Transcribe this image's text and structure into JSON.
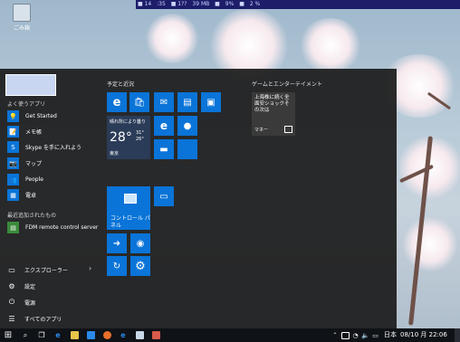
{
  "desktop": {
    "icon_label": "ごみ箱",
    "topbar_items": [
      "■ 14",
      ":35",
      "■ 1??",
      "39 MB",
      "■",
      "9%",
      "■",
      "2 %"
    ]
  },
  "start_menu": {
    "frequent_header": "よく使うアプリ",
    "recent_header": "最近追加されたもの",
    "frequent_apps": [
      {
        "label": "Get Started",
        "icon": "lightbulb-icon",
        "glyph": "💡",
        "color": "#0a74d8"
      },
      {
        "label": "メモ帳",
        "icon": "notepad-icon",
        "glyph": "📝",
        "color": "#0a74d8"
      },
      {
        "label": "Skype を手に入れよう",
        "icon": "skype-icon",
        "glyph": "S",
        "color": "#0a74d8"
      },
      {
        "label": "マップ",
        "icon": "maps-icon",
        "glyph": "📷",
        "color": "#0a74d8"
      },
      {
        "label": "People",
        "icon": "people-icon",
        "glyph": "👥",
        "color": "#0a74d8"
      },
      {
        "label": "電卓",
        "icon": "calculator-icon",
        "glyph": "▦",
        "color": "#0a74d8"
      }
    ],
    "recent_apps": [
      {
        "label": "FDM remote control server",
        "icon": "fdm-icon",
        "glyph": "▤",
        "color": "#3a8a3a"
      }
    ],
    "system_items": [
      {
        "label": "エクスプローラー",
        "icon": "folder-icon",
        "glyph": "▭",
        "has_chevron": true
      },
      {
        "label": "設定",
        "icon": "gear-icon",
        "glyph": "⚙",
        "has_chevron": false
      },
      {
        "label": "電源",
        "icon": "power-icon",
        "glyph": "⏻",
        "has_chevron": false
      },
      {
        "label": "すべてのアプリ",
        "icon": "list-icon",
        "glyph": "☰",
        "has_chevron": false
      }
    ],
    "chevron": "›"
  },
  "tiles": {
    "group1_header": "予定と近況",
    "group2_header": "ゲームとエンターテイメント",
    "weather": {
      "caption": "晴れ所により曇り",
      "temp": "28°",
      "hi": "31°",
      "lo": "26°",
      "location": "東京"
    },
    "control_panel_label": "コントロール パネル",
    "news": {
      "title": "上海株に続く全面安ショックその次は",
      "source": "マネー"
    }
  },
  "taskbar": {
    "clock": "08/10 月 22:06",
    "ime": "日本"
  },
  "colors": {
    "tile_blue": "#0a74d8",
    "start_bg": "#1c1c1c",
    "taskbar": "#0f1216"
  }
}
